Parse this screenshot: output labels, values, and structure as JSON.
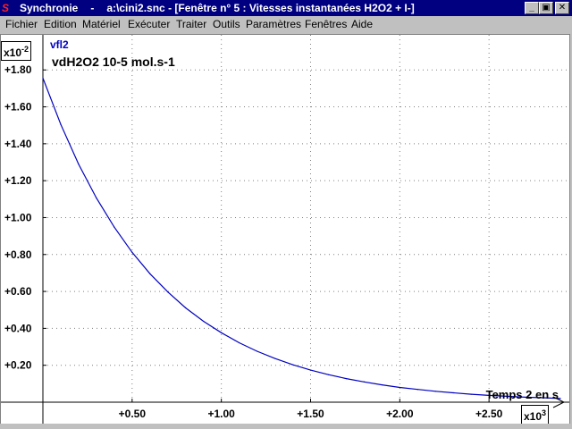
{
  "titlebar": {
    "app_name": "Synchronie",
    "separator": "-",
    "file": "a:\\cini2.snc",
    "window": "[Fenêtre n° 5 : Vitesses instantanées H2O2 + I-]",
    "icon_letter": "S",
    "buttons": {
      "minimize": "_",
      "restore": "▣",
      "close": "✕"
    }
  },
  "menu": {
    "items": [
      "Fichier",
      "Edition",
      "Matériel",
      "Exécuter",
      "Traiter",
      "Outils",
      "Paramètres",
      "Fenêtres",
      "Aide"
    ]
  },
  "chart_data": {
    "type": "line",
    "series": [
      {
        "name": "vfl2",
        "color": "#0000c0",
        "x": [
          0,
          100,
          200,
          300,
          400,
          500,
          600,
          700,
          800,
          900,
          1000,
          1100,
          1200,
          1300,
          1400,
          1500,
          1600,
          1700,
          1800,
          1900,
          2000,
          2100,
          2200,
          2300,
          2400,
          2500,
          2600,
          2700,
          2800,
          2900
        ],
        "y": [
          0.01756,
          0.01505,
          0.0129,
          0.01106,
          0.00948,
          0.00812,
          0.00696,
          0.00597,
          0.00511,
          0.00438,
          0.00376,
          0.00322,
          0.00276,
          0.00237,
          0.00203,
          0.00174,
          0.00149,
          0.00128,
          0.0011,
          0.00094,
          0.0008,
          0.00069,
          0.00059,
          0.00051,
          0.00043,
          0.00037,
          0.00032,
          0.00027,
          0.00024,
          0.0002
        ]
      }
    ],
    "series_label": "vfl2",
    "ylabel": "vdH2O2 10-5 mol.s-1",
    "xlabel": "Temps 2 en s",
    "y_multiplier": {
      "base": "x10",
      "exp": "-2"
    },
    "x_multiplier": {
      "base": "x10",
      "exp": "3"
    },
    "y_ticks": [
      "+0.20",
      "+0.40",
      "+0.60",
      "+0.80",
      "+1.00",
      "+1.20",
      "+1.40",
      "+1.60",
      "+1.80"
    ],
    "y_tick_values": [
      0.002,
      0.004,
      0.006,
      0.008,
      0.01,
      0.012,
      0.014,
      0.016,
      0.018
    ],
    "x_ticks": [
      "+0.50",
      "+1.00",
      "+1.50",
      "+2.00",
      "+2.50"
    ],
    "x_tick_values": [
      500,
      1000,
      1500,
      2000,
      2500
    ],
    "xlim": [
      0,
      2950
    ],
    "ylim": [
      0,
      0.0199
    ],
    "grid": true,
    "grid_style": "dotted"
  }
}
